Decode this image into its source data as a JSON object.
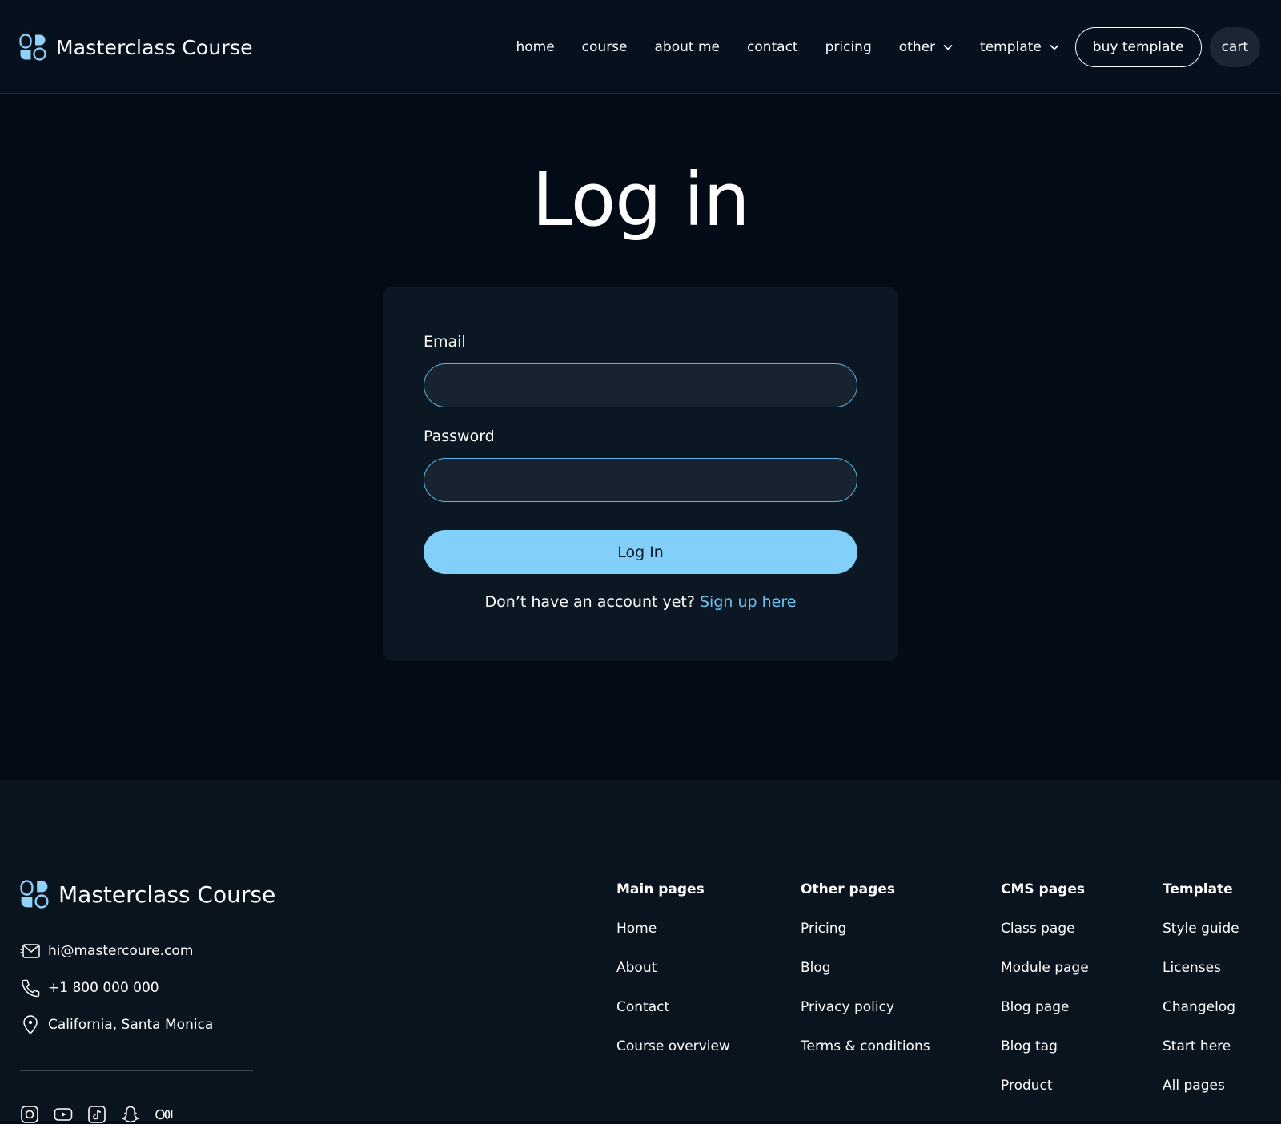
{
  "colors": {
    "background": "#030c16",
    "header_bg": "#06111d",
    "card_bg": "#0b1722",
    "input_bg": "#17232e",
    "accent": "#82cffa",
    "link": "#6cc3f5",
    "footer_bg": "#0a141f"
  },
  "header": {
    "brand_name": "Masterclass Course",
    "nav": {
      "home": "home",
      "course": "course",
      "about": "about me",
      "contact": "contact",
      "pricing": "pricing",
      "other": "other",
      "template": "template"
    },
    "buy_label": "buy template",
    "cart_label": "cart"
  },
  "main": {
    "title": "Log in",
    "email_label": "Email",
    "email_value": "",
    "password_label": "Password",
    "password_value": "",
    "submit_label": "Log In",
    "signup_prompt": "Don’t have an account yet? ",
    "signup_link": "Sign up here"
  },
  "footer": {
    "brand_name": "Masterclass Course",
    "email": "hi@mastercoure.com",
    "phone": "+1 800 000 000",
    "address": "California, Santa Monica",
    "socials": [
      "instagram-icon",
      "youtube-icon",
      "tiktok-icon",
      "snapchat-icon",
      "medium-icon"
    ],
    "columns": [
      {
        "heading": "Main pages",
        "links": [
          "Home",
          "About",
          "Contact",
          "Course overview"
        ]
      },
      {
        "heading": "Other pages",
        "links": [
          "Pricing",
          "Blog",
          "Privacy policy",
          "Terms & conditions"
        ]
      },
      {
        "heading": "CMS pages",
        "links": [
          "Class page",
          "Module page",
          "Blog page",
          "Blog tag",
          "Product"
        ]
      },
      {
        "heading": "Template",
        "links": [
          "Style guide",
          "Licenses",
          "Changelog",
          "Start here",
          "All pages"
        ]
      }
    ]
  }
}
